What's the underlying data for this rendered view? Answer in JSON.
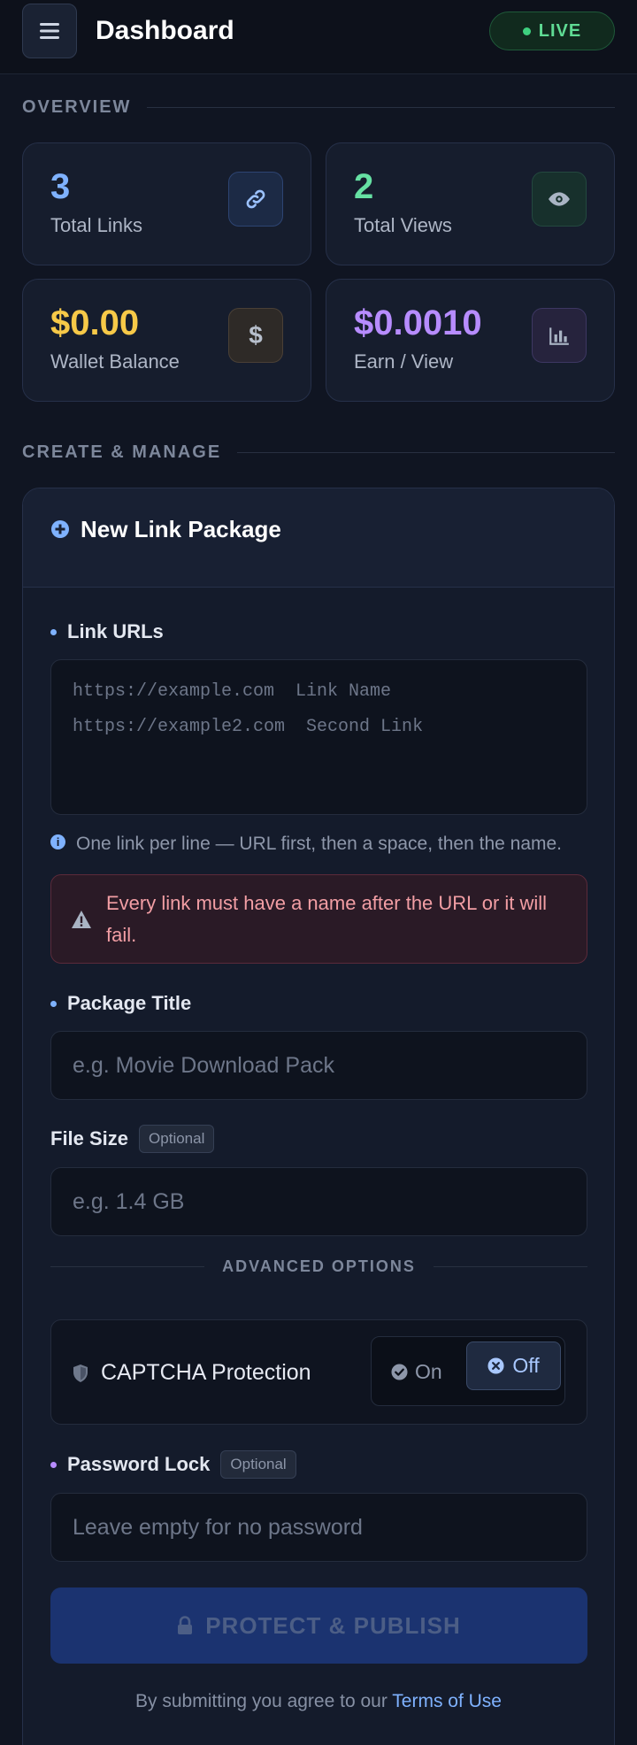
{
  "header": {
    "title": "Dashboard",
    "live_label": "LIVE"
  },
  "overview": {
    "section_label": "OVERVIEW",
    "stats": [
      {
        "value": "3",
        "label": "Total Links",
        "icon": "link-icon",
        "color": "#7fb2ff"
      },
      {
        "value": "2",
        "label": "Total Views",
        "icon": "eye-icon",
        "color": "#66e0a3"
      },
      {
        "value": "$0.00",
        "label": "Wallet Balance",
        "icon": "dollar-icon",
        "color": "#f7c948"
      },
      {
        "value": "$0.0010",
        "label": "Earn / View",
        "icon": "bar-chart-icon",
        "color": "#b78cff"
      }
    ]
  },
  "create": {
    "section_label": "CREATE & MANAGE",
    "card_title": "New Link Package",
    "link_urls_label": "Link URLs",
    "link_urls_placeholder": "https://example.com  Link Name\nhttps://example2.com  Second Link",
    "hint": "One link per line — URL first, then a space, then the name.",
    "alert": "Every link must have a name after the URL or it will fail.",
    "package_title_label": "Package Title",
    "package_title_placeholder": "e.g. Movie Download Pack",
    "file_size_label": "File Size",
    "optional_badge": "Optional",
    "file_size_placeholder": "e.g. 1.4 GB",
    "advanced_label": "ADVANCED OPTIONS",
    "captcha_label": "CAPTCHA Protection",
    "toggle_on": "On",
    "toggle_off": "Off",
    "password_label": "Password Lock",
    "password_placeholder": "Leave empty for no password",
    "publish_label": "PROTECT & PUBLISH",
    "terms_prefix": "By submitting you agree to our",
    "terms_link": "Terms of Use"
  }
}
